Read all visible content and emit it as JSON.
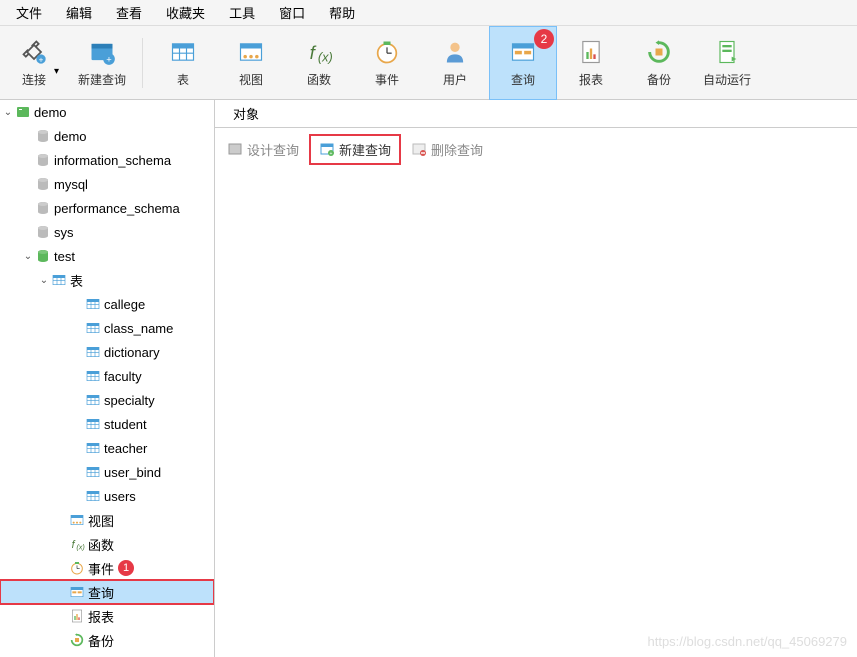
{
  "menubar": [
    "文件",
    "编辑",
    "查看",
    "收藏夹",
    "工具",
    "窗口",
    "帮助"
  ],
  "toolbar": [
    {
      "label": "连接",
      "icon": "plug",
      "selected": false,
      "dropdown": true
    },
    {
      "label": "新建查询",
      "icon": "new-query",
      "selected": false
    },
    {
      "divider": true
    },
    {
      "label": "表",
      "icon": "table",
      "selected": false
    },
    {
      "label": "视图",
      "icon": "view",
      "selected": false
    },
    {
      "label": "函数",
      "icon": "fx",
      "selected": false
    },
    {
      "label": "事件",
      "icon": "clock",
      "selected": false
    },
    {
      "label": "用户",
      "icon": "user",
      "selected": false
    },
    {
      "label": "查询",
      "icon": "query",
      "selected": true,
      "badge": "2",
      "redbox": true
    },
    {
      "label": "报表",
      "icon": "report",
      "selected": false
    },
    {
      "label": "备份",
      "icon": "backup",
      "selected": false
    },
    {
      "label": "自动运行",
      "icon": "autorun",
      "selected": false
    }
  ],
  "tree": [
    {
      "label": "demo",
      "icon": "server-green",
      "toggle": "open",
      "indent": 0
    },
    {
      "label": "demo",
      "icon": "db",
      "indent": 1
    },
    {
      "label": "information_schema",
      "icon": "db",
      "indent": 1
    },
    {
      "label": "mysql",
      "icon": "db",
      "indent": 1
    },
    {
      "label": "performance_schema",
      "icon": "db",
      "indent": 1
    },
    {
      "label": "sys",
      "icon": "db",
      "indent": 1
    },
    {
      "label": "test",
      "icon": "db-green",
      "toggle": "open",
      "indent": 1
    },
    {
      "label": "表",
      "icon": "table",
      "toggle": "open",
      "indent": 2
    },
    {
      "label": "callege",
      "icon": "table",
      "indent": 3
    },
    {
      "label": "class_name",
      "icon": "table",
      "indent": 3
    },
    {
      "label": "dictionary",
      "icon": "table",
      "indent": 3
    },
    {
      "label": "faculty",
      "icon": "table",
      "indent": 3
    },
    {
      "label": "specialty",
      "icon": "table",
      "indent": 3
    },
    {
      "label": "student",
      "icon": "table",
      "indent": 3
    },
    {
      "label": "teacher",
      "icon": "table",
      "indent": 3
    },
    {
      "label": "user_bind",
      "icon": "table",
      "indent": 3
    },
    {
      "label": "users",
      "icon": "table",
      "indent": 3
    },
    {
      "label": "视图",
      "icon": "view",
      "indent": 2,
      "sub": true
    },
    {
      "label": "函数",
      "icon": "fx",
      "indent": 2,
      "sub": true
    },
    {
      "label": "事件",
      "icon": "clock",
      "indent": 2,
      "sub": true,
      "badge": "1"
    },
    {
      "label": "查询",
      "icon": "query",
      "indent": 2,
      "sub": true,
      "selected": true,
      "redbox": true
    },
    {
      "label": "报表",
      "icon": "report",
      "indent": 2,
      "sub": true
    },
    {
      "label": "备份",
      "icon": "backup",
      "indent": 2,
      "sub": true
    }
  ],
  "content": {
    "tab": "对象",
    "buttons": [
      {
        "label": "设计查询",
        "icon": "design",
        "disabled": true
      },
      {
        "label": "新建查询",
        "icon": "new",
        "redbox": true
      },
      {
        "label": "删除查询",
        "icon": "delete",
        "disabled": true
      }
    ]
  },
  "watermark": "https://blog.csdn.net/qq_45069279"
}
